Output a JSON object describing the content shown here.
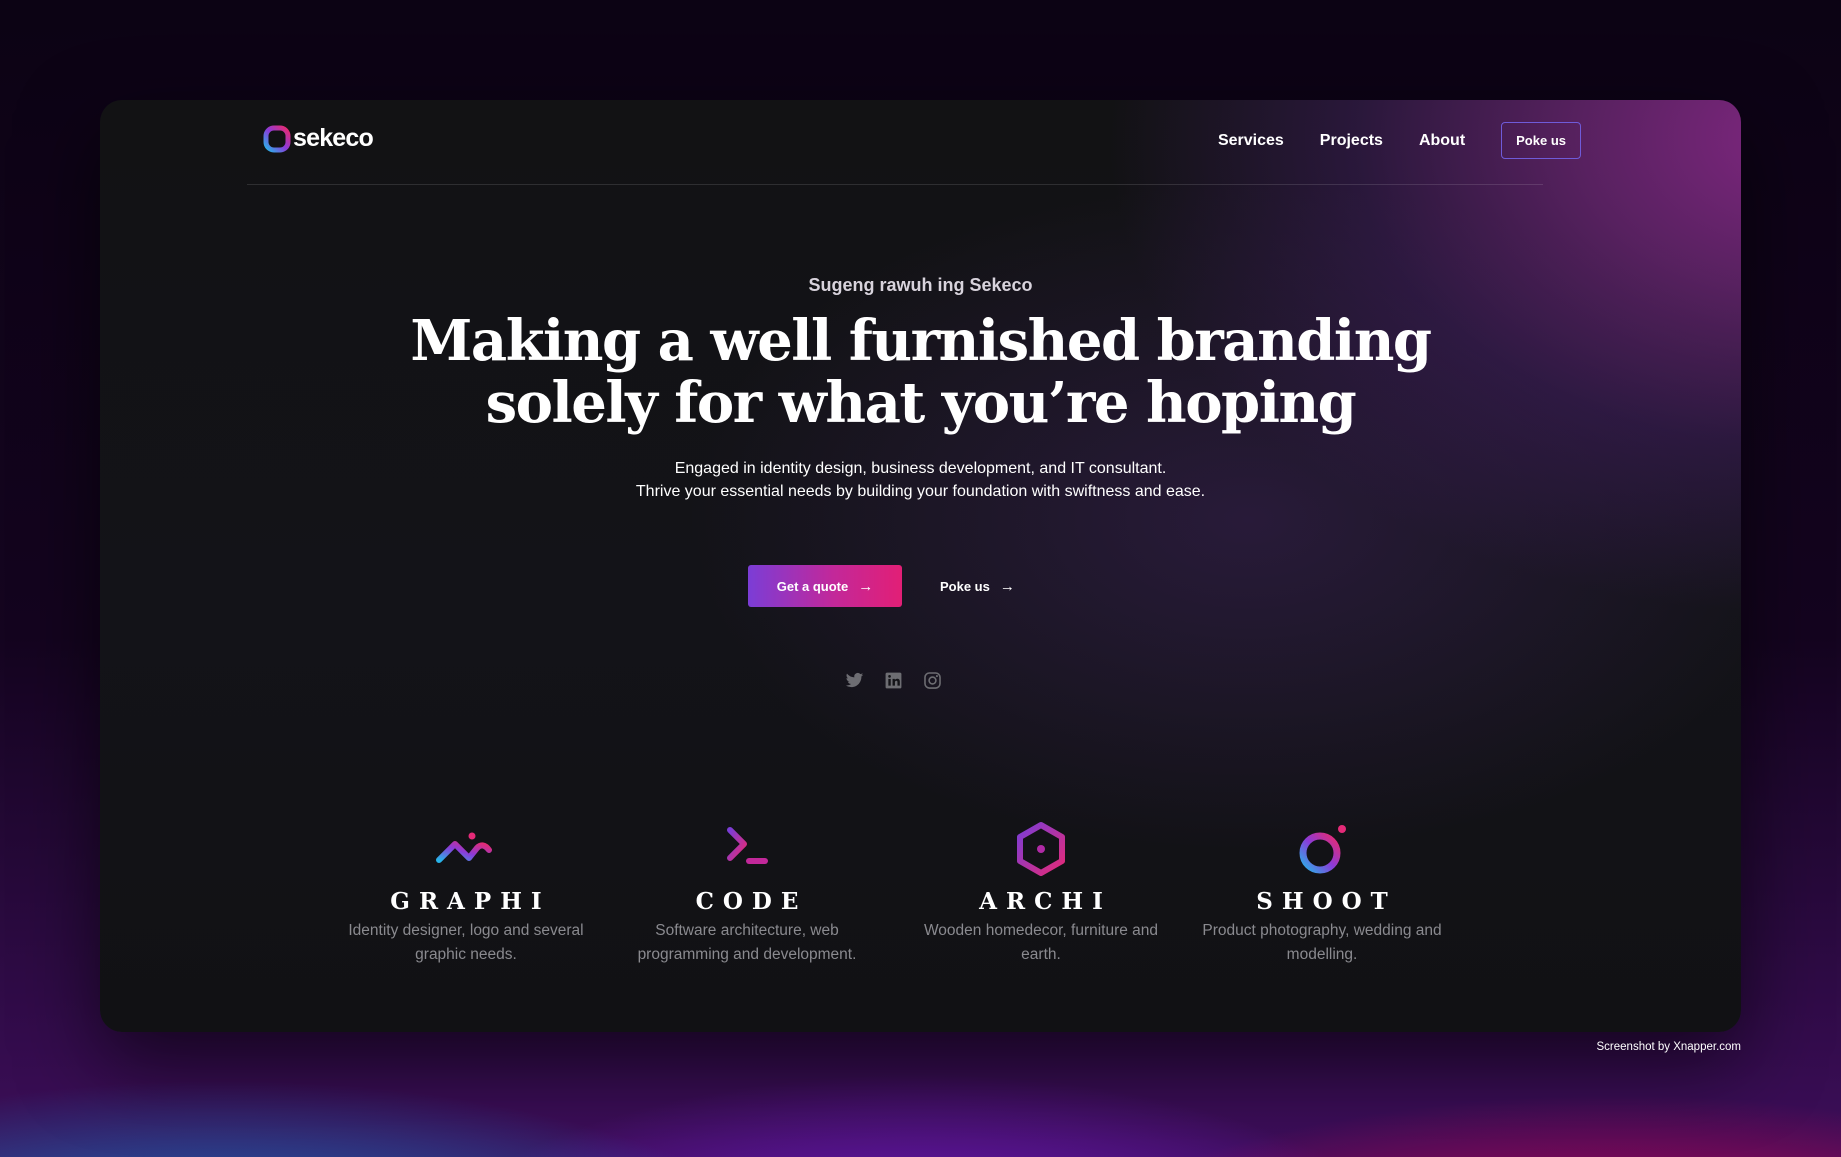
{
  "brand": {
    "name": "sekeco"
  },
  "nav": {
    "items": [
      {
        "label": "Services"
      },
      {
        "label": "Projects"
      },
      {
        "label": "About"
      }
    ],
    "cta_label": "Poke us"
  },
  "hero": {
    "eyebrow": "Sugeng rawuh ing Sekeco",
    "headline_line1": "Making a well furnished branding",
    "headline_line2": "solely for what you’re hoping",
    "subtitle_line1": "Engaged in identity design, business development, and IT consultant.",
    "subtitle_line2": "Thrive your essential needs by building your foundation with swiftness and ease.",
    "primary_button": "Get a quote",
    "secondary_button": "Poke us"
  },
  "socials": [
    {
      "icon": "twitter-icon"
    },
    {
      "icon": "linkedin-icon"
    },
    {
      "icon": "instagram-icon"
    }
  ],
  "services": [
    {
      "name": "GRAPHI",
      "desc_line1": "Identity designer, logo and several",
      "desc_line2": "graphic needs.",
      "icon": "graphi-icon"
    },
    {
      "name": "CODE",
      "desc_line1": "Software architecture, web",
      "desc_line2": "programming and development.",
      "icon": "code-icon"
    },
    {
      "name": "ARCHI",
      "desc_line1": "Wooden homedecor, furniture and",
      "desc_line2": "earth.",
      "icon": "archi-icon"
    },
    {
      "name": "SHOOT",
      "desc_line1": "Product photography, wedding and",
      "desc_line2": "modelling.",
      "icon": "shoot-icon"
    }
  ],
  "footer": {
    "credit": "Screenshot by Xnapper.com"
  },
  "colors": {
    "accent_purple": "#7b3dd6",
    "accent_pink": "#e21f76",
    "window_bg": "#121214",
    "text": "#ffffff",
    "muted": "#8a8a8f"
  }
}
